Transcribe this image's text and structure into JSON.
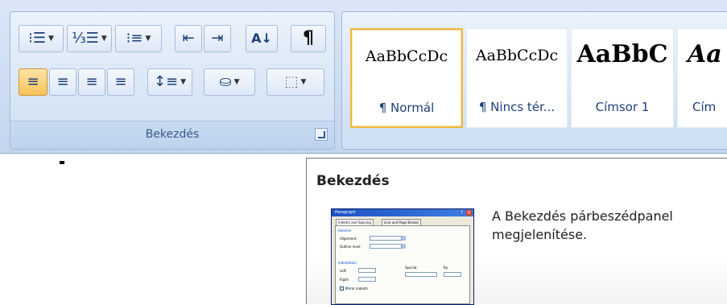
{
  "paragraph_group": {
    "label": "Bekezdés",
    "launcher_icon": "dialog-launcher-icon",
    "row1": [
      {
        "name": "bullets",
        "icon": "bullet-list-icon",
        "glyph": "⁝☰",
        "dropdown": true
      },
      {
        "name": "numbering",
        "icon": "numbered-list-icon",
        "glyph": "⅓☰",
        "dropdown": true
      },
      {
        "name": "multilevel",
        "icon": "multilevel-list-icon",
        "glyph": "⁝≡",
        "dropdown": true
      },
      {
        "name": "decrease-indent",
        "icon": "decrease-indent-icon",
        "glyph": "⇤",
        "dropdown": false
      },
      {
        "name": "increase-indent",
        "icon": "increase-indent-icon",
        "glyph": "⇥",
        "dropdown": false
      },
      {
        "name": "sort",
        "icon": "sort-az-icon",
        "glyph": "A↓",
        "dropdown": false
      },
      {
        "name": "show-marks",
        "icon": "pilcrow-icon",
        "glyph": "¶",
        "dropdown": false
      }
    ],
    "row2": [
      {
        "name": "align-left",
        "icon": "align-left-icon",
        "glyph": "≡",
        "active": true
      },
      {
        "name": "align-center",
        "icon": "align-center-icon",
        "glyph": "≡",
        "active": false
      },
      {
        "name": "align-right",
        "icon": "align-right-icon",
        "glyph": "≡",
        "active": false
      },
      {
        "name": "justify",
        "icon": "justify-icon",
        "glyph": "≡",
        "active": false
      },
      {
        "name": "line-spacing",
        "icon": "line-spacing-icon",
        "glyph": "↕≡",
        "active": false
      },
      {
        "name": "shading",
        "icon": "shading-bucket-icon",
        "glyph": "⛀",
        "active": false
      },
      {
        "name": "borders",
        "icon": "borders-icon",
        "glyph": "⬚",
        "active": false
      }
    ]
  },
  "styles_gallery": {
    "items": [
      {
        "sample": "AaBbCcDc",
        "name": "¶ Normál",
        "selected": true
      },
      {
        "sample": "AaBbCcDc",
        "name": "¶ Nincs tér...",
        "selected": false
      },
      {
        "sample": "AaBbC",
        "name": "Címsor 1",
        "selected": false
      },
      {
        "sample": "Aa",
        "name": "Cím",
        "selected": false
      }
    ]
  },
  "tooltip": {
    "title": "Bekezdés",
    "description": "A Bekezdés párbeszédpanel megjelenítése.",
    "thumbnail": {
      "title": "Paragraph",
      "tabs": [
        "Indents and Spacing",
        "Line and Page Breaks"
      ],
      "sections": [
        "General",
        "Indentation"
      ],
      "labels": [
        "Alignment:",
        "Outline level:",
        "Left:",
        "Right:",
        "Special:",
        "By:",
        "Mirror indents"
      ],
      "values": [
        "Left",
        "Body Text",
        "0\"",
        "0\"",
        "(none)"
      ]
    }
  }
}
